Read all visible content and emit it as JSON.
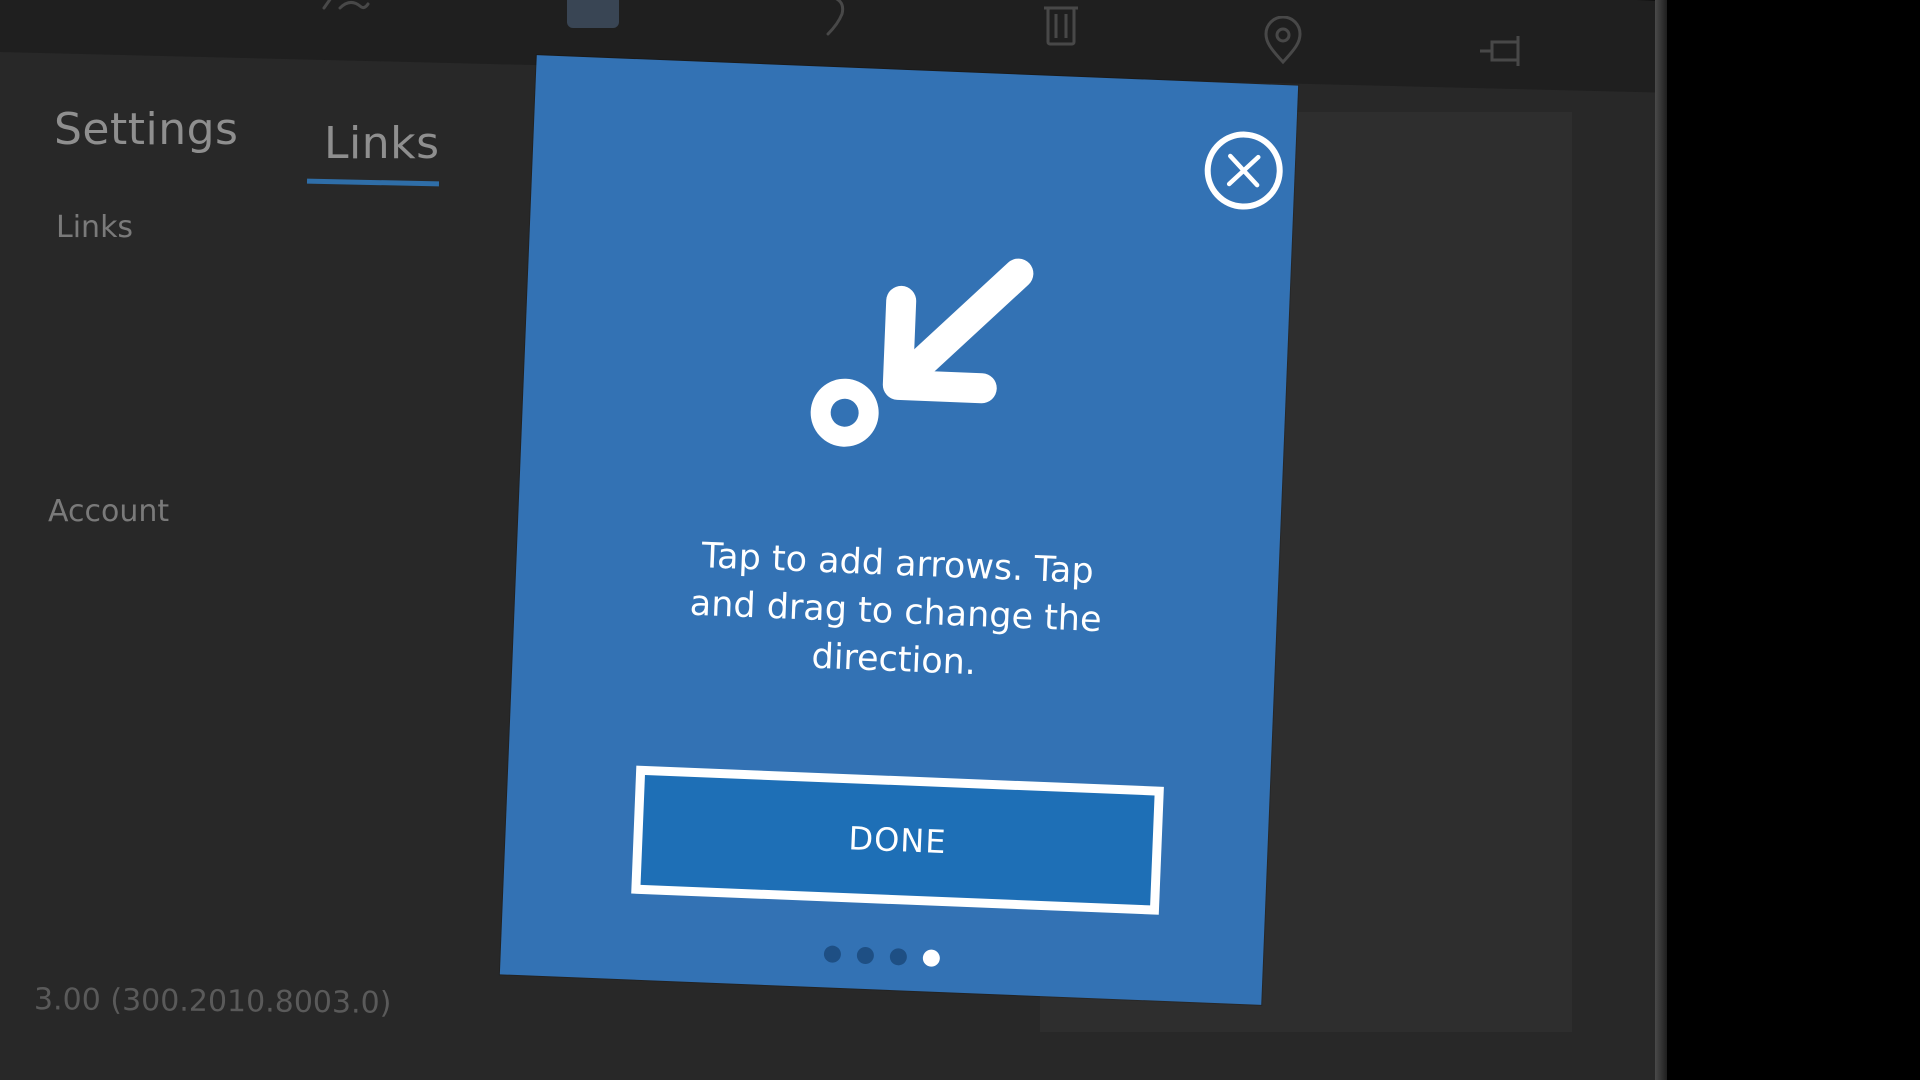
{
  "toolbar": {
    "icons": [
      "pen-icon",
      "color-swatch-icon",
      "undo-icon",
      "trash-icon",
      "location-icon",
      "pin-icon"
    ]
  },
  "tabs": [
    {
      "label": "Settings",
      "selected": false
    },
    {
      "label": "Links",
      "selected": true
    }
  ],
  "sections": {
    "links_label": "Links",
    "account_label": "Account"
  },
  "version": "3.00 (300.2010.8003.0)",
  "modal": {
    "message": "Tap to add arrows. Tap and drag to change the direction.",
    "done_label": "DONE",
    "page_count": 4,
    "current_page": 4
  },
  "colors": {
    "modal_bg": "#3372b4",
    "button_bg": "#1e6fb6",
    "accent": "#2f6ea8",
    "app_bg": "#282828"
  }
}
